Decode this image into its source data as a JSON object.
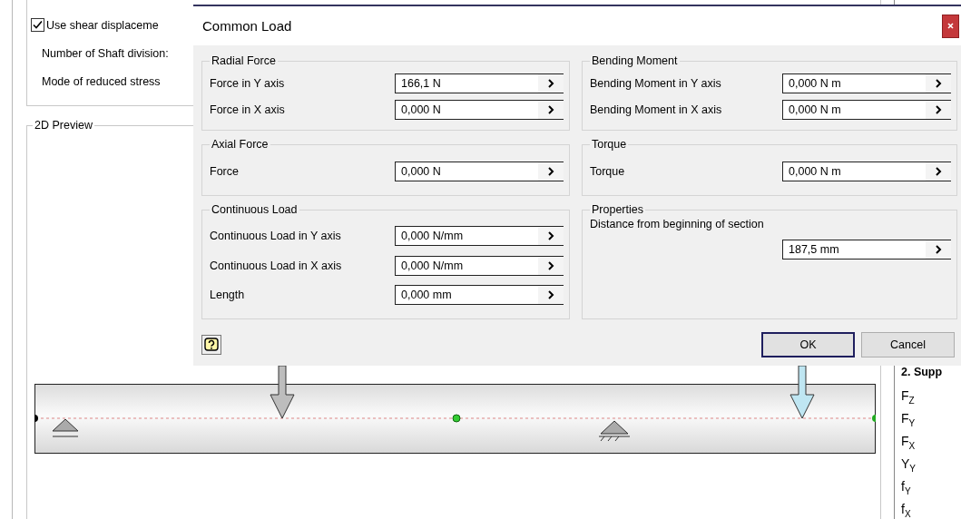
{
  "background": {
    "options": {
      "checkbox": {
        "label": "Use shear displaceme",
        "checked": true
      },
      "labels": [
        "Number of Shaft division:",
        "Mode of reduced stress"
      ]
    },
    "preview": {
      "title": "2D Preview"
    },
    "side_panel": {
      "header": "2. Supp",
      "items": [
        "F$_{Z}$",
        "F$_{Y}$",
        "F$_{X}$",
        "Y$_{Y}$",
        "f$_{Y}$",
        "f$_{X}$"
      ]
    }
  },
  "dialog": {
    "title": "Common Load",
    "rows": [
      [
        {
          "title": "Radial Force",
          "fields": [
            {
              "kind": "inline",
              "label": "Force in Y axis",
              "value": "166,1 N"
            },
            {
              "kind": "inline",
              "label": "Force in X axis",
              "value": "0,000 N"
            }
          ]
        },
        {
          "title": "Bending Moment",
          "fields": [
            {
              "kind": "inline",
              "label": "Bending Moment in Y axis",
              "value": "0,000 N m"
            },
            {
              "kind": "inline",
              "label": "Bending Moment in X axis",
              "value": "0,000 N m"
            }
          ]
        }
      ],
      [
        {
          "title": "Axial Force",
          "fields": [
            {
              "kind": "inline",
              "label": "Force",
              "value": "0,000 N"
            }
          ]
        },
        {
          "title": "Torque",
          "fields": [
            {
              "kind": "inline",
              "label": "Torque",
              "value": "0,000 N m"
            }
          ]
        }
      ],
      [
        {
          "title": "Continuous Load",
          "fields": [
            {
              "kind": "inline",
              "label": "Continuous Load in Y axis",
              "value": "0,000 N/mm"
            },
            {
              "kind": "inline",
              "label": "Continuous Load in X axis",
              "value": "0,000 N/mm"
            },
            {
              "kind": "inline",
              "label": "Length",
              "value": "0,000 mm"
            }
          ]
        },
        {
          "title": "Properties",
          "fields": [
            {
              "kind": "stacked",
              "label": "Distance from beginning of section",
              "value": "187,5 mm"
            }
          ]
        }
      ]
    ],
    "buttons": [
      {
        "label": "OK",
        "focused": true
      },
      {
        "label": "Cancel",
        "focused": false
      }
    ]
  }
}
